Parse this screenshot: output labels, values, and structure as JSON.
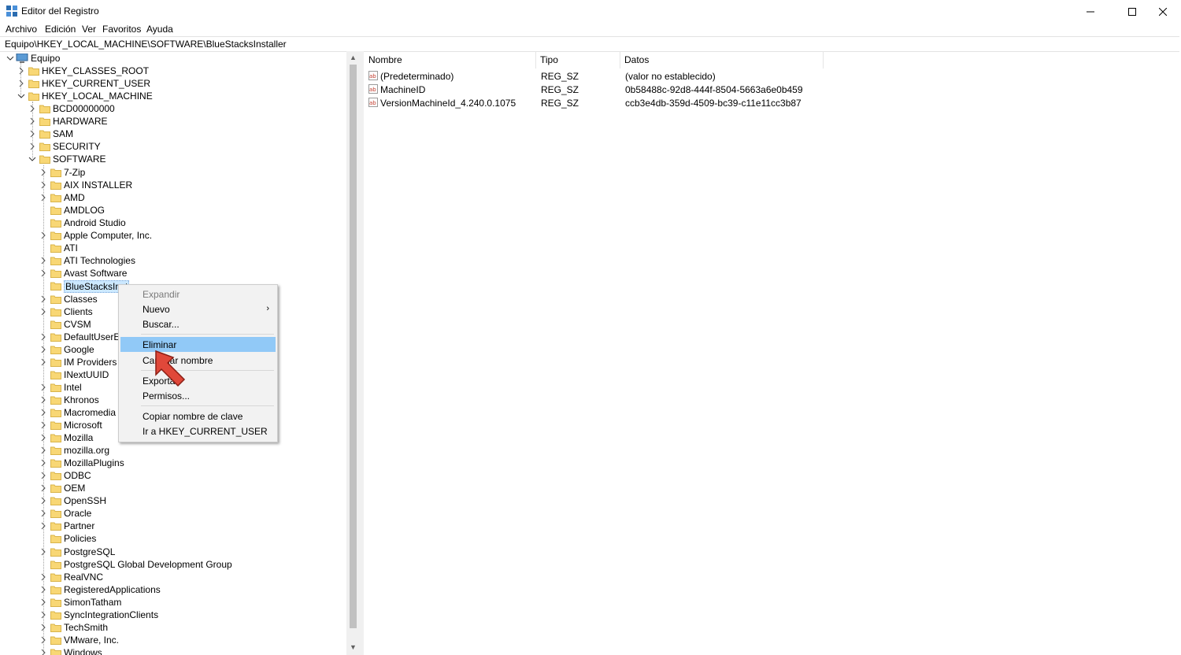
{
  "window": {
    "title": "Editor del Registro",
    "minimize": "—",
    "maximize": "☐",
    "close": "✕"
  },
  "menu": [
    "Archivo",
    "Edición",
    "Ver",
    "Favoritos",
    "Ayuda"
  ],
  "address": "Equipo\\HKEY_LOCAL_MACHINE\\SOFTWARE\\BlueStacksInstaller",
  "tree": {
    "root": "Equipo",
    "hives": [
      "HKEY_CLASSES_ROOT",
      "HKEY_CURRENT_USER",
      "HKEY_LOCAL_MACHINE"
    ],
    "hklm": [
      "BCD00000000",
      "HARDWARE",
      "SAM",
      "SECURITY",
      "SOFTWARE"
    ],
    "software": [
      "7-Zip",
      "AIX INSTALLER",
      "AMD",
      "AMDLOG",
      "Android Studio",
      "Apple Computer, Inc.",
      "ATI",
      "ATI Technologies",
      "Avast Software",
      "BlueStacksInst",
      "Classes",
      "Clients",
      "CVSM",
      "DefaultUserEnv",
      "Google",
      "IM Providers",
      "INextUUID",
      "Intel",
      "Khronos",
      "Macromedia",
      "Microsoft",
      "Mozilla",
      "mozilla.org",
      "MozillaPlugins",
      "ODBC",
      "OEM",
      "OpenSSH",
      "Oracle",
      "Partner",
      "Policies",
      "PostgreSQL",
      "PostgreSQL Global Development Group",
      "RealVNC",
      "RegisteredApplications",
      "SimonTatham",
      "SyncIntegrationClients",
      "TechSmith",
      "VMware, Inc.",
      "Windows"
    ]
  },
  "columns": {
    "name": "Nombre",
    "type": "Tipo",
    "data": "Datos"
  },
  "values": [
    {
      "name": "(Predeterminado)",
      "type": "REG_SZ",
      "data": "(valor no establecido)"
    },
    {
      "name": "MachineID",
      "type": "REG_SZ",
      "data": "0b58488c-92d8-444f-8504-5663a6e0b459"
    },
    {
      "name": "VersionMachineId_4.240.0.1075",
      "type": "REG_SZ",
      "data": "ccb3e4db-359d-4509-bc39-c11e11cc3b87"
    }
  ],
  "context_menu": {
    "expand": "Expandir",
    "new": "Nuevo",
    "find": "Buscar...",
    "delete": "Eliminar",
    "rename": "Cambiar nombre",
    "export": "Exportar",
    "permissions": "Permisos...",
    "copy_key_name": "Copiar nombre de clave",
    "goto_hkcu": "Ir a HKEY_CURRENT_USER"
  },
  "colors": {
    "selection": "#cce8ff",
    "menu_highlight": "#91c9f7",
    "folder": "#f8d775",
    "pointer": "#e0483a"
  }
}
